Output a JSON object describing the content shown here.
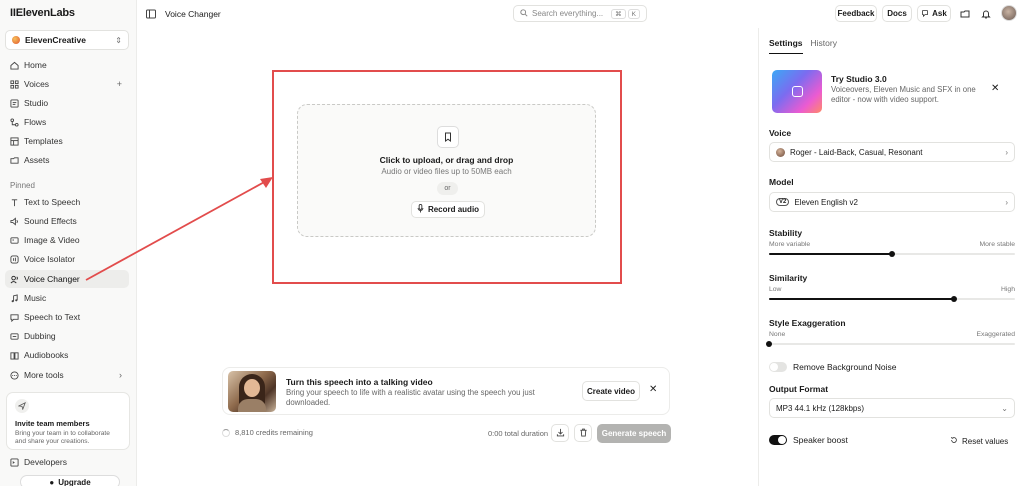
{
  "app": {
    "logo": "IIElevenLabs",
    "workspace": "ElevenCreative"
  },
  "sidebar": {
    "nav": [
      {
        "label": "Home",
        "icon": "home-icon"
      },
      {
        "label": "Voices",
        "icon": "voices-icon",
        "plus": "+"
      },
      {
        "label": "Studio",
        "icon": "studio-icon"
      },
      {
        "label": "Flows",
        "icon": "flows-icon"
      },
      {
        "label": "Templates",
        "icon": "templates-icon"
      },
      {
        "label": "Assets",
        "icon": "assets-icon"
      }
    ],
    "pinned_heading": "Pinned",
    "pinned": [
      {
        "label": "Text to Speech",
        "icon": "text-to-speech-icon"
      },
      {
        "label": "Sound Effects",
        "icon": "sound-effects-icon"
      },
      {
        "label": "Image & Video",
        "icon": "image-video-icon"
      },
      {
        "label": "Voice Isolator",
        "icon": "voice-isolator-icon"
      },
      {
        "label": "Voice Changer",
        "icon": "voice-changer-icon",
        "active": true
      },
      {
        "label": "Music",
        "icon": "music-icon"
      },
      {
        "label": "Speech to Text",
        "icon": "speech-to-text-icon"
      },
      {
        "label": "Dubbing",
        "icon": "dubbing-icon"
      },
      {
        "label": "Audiobooks",
        "icon": "audiobooks-icon"
      },
      {
        "label": "More tools",
        "icon": "more-tools-icon",
        "arrow": "›"
      }
    ],
    "invite": {
      "title": "Invite team members",
      "desc": "Bring your team in to collaborate and share your creations."
    },
    "developers": "Developers",
    "upgrade": "Upgrade"
  },
  "topbar": {
    "page_title": "Voice Changer",
    "search_placeholder": "Search everything...",
    "kbd1": "⌘",
    "kbd2": "K",
    "feedback": "Feedback",
    "docs": "Docs",
    "ask": "Ask"
  },
  "upload": {
    "title": "Click to upload, or drag and drop",
    "subtitle": "Audio or video files up to 50MB each",
    "or": "or",
    "record": "Record audio"
  },
  "banner": {
    "title": "Turn this speech into a talking video",
    "desc": "Bring your speech to life with a realistic avatar using the speech you just downloaded.",
    "cta": "Create video"
  },
  "footer": {
    "credits": "8,810 credits remaining",
    "duration": "0:00 total duration",
    "generate": "Generate speech"
  },
  "panel": {
    "tabs": [
      "Settings",
      "History"
    ],
    "studio": {
      "title": "Try Studio 3.0",
      "desc": "Voiceovers, Eleven Music and SFX in one editor - now with video support."
    },
    "voice_label": "Voice",
    "voice_value": "Roger - Laid-Back, Casual, Resonant",
    "model_label": "Model",
    "model_badge": "V2",
    "model_value": "Eleven English v2",
    "stability": {
      "label": "Stability",
      "min": "More variable",
      "max": "More stable",
      "value": 0.5
    },
    "similarity": {
      "label": "Similarity",
      "min": "Low",
      "max": "High",
      "value": 0.75
    },
    "style": {
      "label": "Style Exaggeration",
      "min": "None",
      "max": "Exaggerated",
      "value": 0.0
    },
    "remove_noise": {
      "label": "Remove Background Noise",
      "on": false
    },
    "output_label": "Output Format",
    "output_value": "MP3 44.1 kHz (128kbps)",
    "speaker_boost": {
      "label": "Speaker boost",
      "on": true
    },
    "reset": "Reset values"
  },
  "colors": {
    "accent": "#111111",
    "highlight": "#e24c4c",
    "disabled": "#b3b3b1"
  }
}
